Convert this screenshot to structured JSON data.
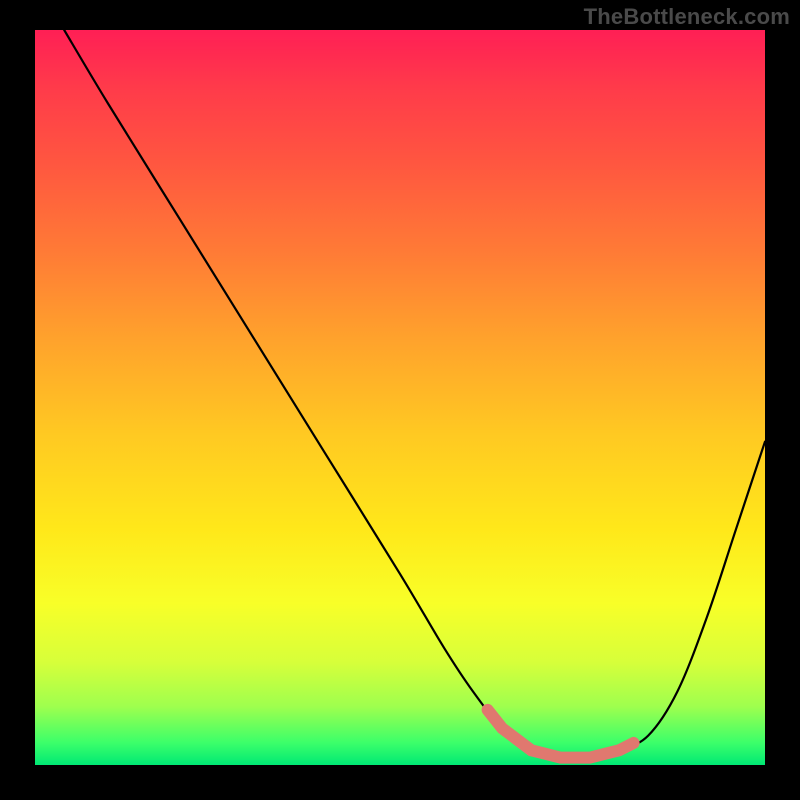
{
  "watermark": "TheBottleneck.com",
  "chart_data": {
    "type": "line",
    "title": "",
    "xlabel": "",
    "ylabel": "",
    "xlim": [
      0,
      100
    ],
    "ylim": [
      0,
      100
    ],
    "series": [
      {
        "name": "curve",
        "x": [
          4,
          10,
          20,
          30,
          40,
          50,
          56,
          60,
          64,
          68,
          72,
          76,
          80,
          84,
          88,
          92,
          96,
          100
        ],
        "y": [
          100,
          90,
          74,
          58,
          42,
          26,
          16,
          10,
          5,
          2,
          1,
          1,
          2,
          4,
          10,
          20,
          32,
          44
        ]
      }
    ],
    "highlight_band": {
      "x_start": 62,
      "x_end": 82,
      "y": 2,
      "color": "#e0786f"
    },
    "gradient_stops": [
      {
        "pos": 0,
        "color": "#ff1f55"
      },
      {
        "pos": 18,
        "color": "#ff5640"
      },
      {
        "pos": 42,
        "color": "#ffa22c"
      },
      {
        "pos": 68,
        "color": "#ffe81a"
      },
      {
        "pos": 92,
        "color": "#9fff4e"
      },
      {
        "pos": 100,
        "color": "#00e874"
      }
    ]
  }
}
